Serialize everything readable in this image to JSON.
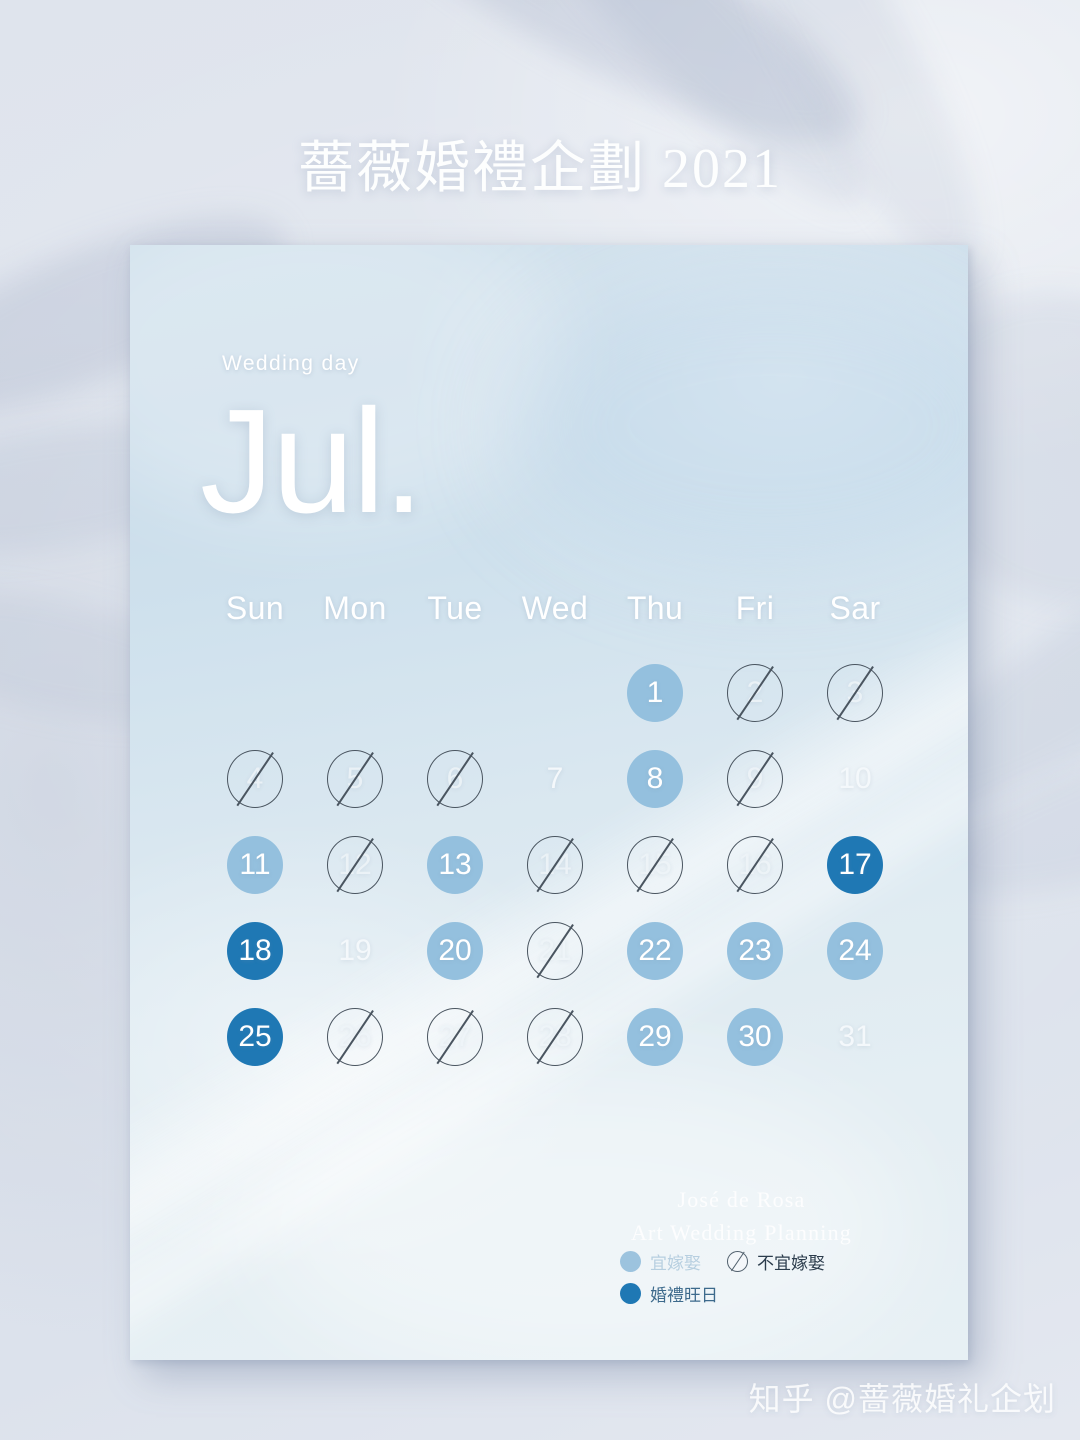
{
  "poster": {
    "title": "薔薇婚禮企劃 2021",
    "watermark": "知乎 @蔷薇婚礼企划"
  },
  "card": {
    "eyebrow": "Wedding day",
    "month": "Jul.",
    "weekdays": [
      "Sun",
      "Mon",
      "Tue",
      "Wed",
      "Thu",
      "Fri",
      "Sar"
    ],
    "signature": {
      "line1": "José de Rosa",
      "line2": "Art Wedding Planning"
    }
  },
  "legend": {
    "items": [
      {
        "label": "宜嫁娶",
        "state": "good"
      },
      {
        "label": "不宜嫁娶",
        "state": "bad"
      },
      {
        "label": "婚禮旺日",
        "state": "best"
      }
    ]
  },
  "colors": {
    "good": "#94c0de",
    "best": "#1f78b4",
    "bad_outline": "#4a5560",
    "plain_text": "#f4f8fb",
    "card_bg": "#d4e3ee",
    "page_bg": "#dde3ec",
    "title_text": "#fdfefe"
  },
  "calendar": {
    "month_name": "Jul.",
    "year": "2021",
    "lead_blanks": 4,
    "days": [
      {
        "num": "1",
        "state": "good"
      },
      {
        "num": "2",
        "state": "bad"
      },
      {
        "num": "3",
        "state": "bad"
      },
      {
        "num": "4",
        "state": "bad"
      },
      {
        "num": "5",
        "state": "bad"
      },
      {
        "num": "6",
        "state": "bad"
      },
      {
        "num": "7",
        "state": "plain"
      },
      {
        "num": "8",
        "state": "good"
      },
      {
        "num": "9",
        "state": "bad"
      },
      {
        "num": "10",
        "state": "plain"
      },
      {
        "num": "11",
        "state": "good"
      },
      {
        "num": "12",
        "state": "bad"
      },
      {
        "num": "13",
        "state": "good"
      },
      {
        "num": "14",
        "state": "bad"
      },
      {
        "num": "15",
        "state": "bad"
      },
      {
        "num": "16",
        "state": "bad"
      },
      {
        "num": "17",
        "state": "best"
      },
      {
        "num": "18",
        "state": "best"
      },
      {
        "num": "19",
        "state": "plain"
      },
      {
        "num": "20",
        "state": "good"
      },
      {
        "num": "21",
        "state": "bad"
      },
      {
        "num": "22",
        "state": "good"
      },
      {
        "num": "23",
        "state": "good"
      },
      {
        "num": "24",
        "state": "good"
      },
      {
        "num": "25",
        "state": "best"
      },
      {
        "num": "26",
        "state": "bad"
      },
      {
        "num": "27",
        "state": "bad"
      },
      {
        "num": "28",
        "state": "bad"
      },
      {
        "num": "29",
        "state": "good"
      },
      {
        "num": "30",
        "state": "good"
      },
      {
        "num": "31",
        "state": "plain"
      }
    ]
  }
}
